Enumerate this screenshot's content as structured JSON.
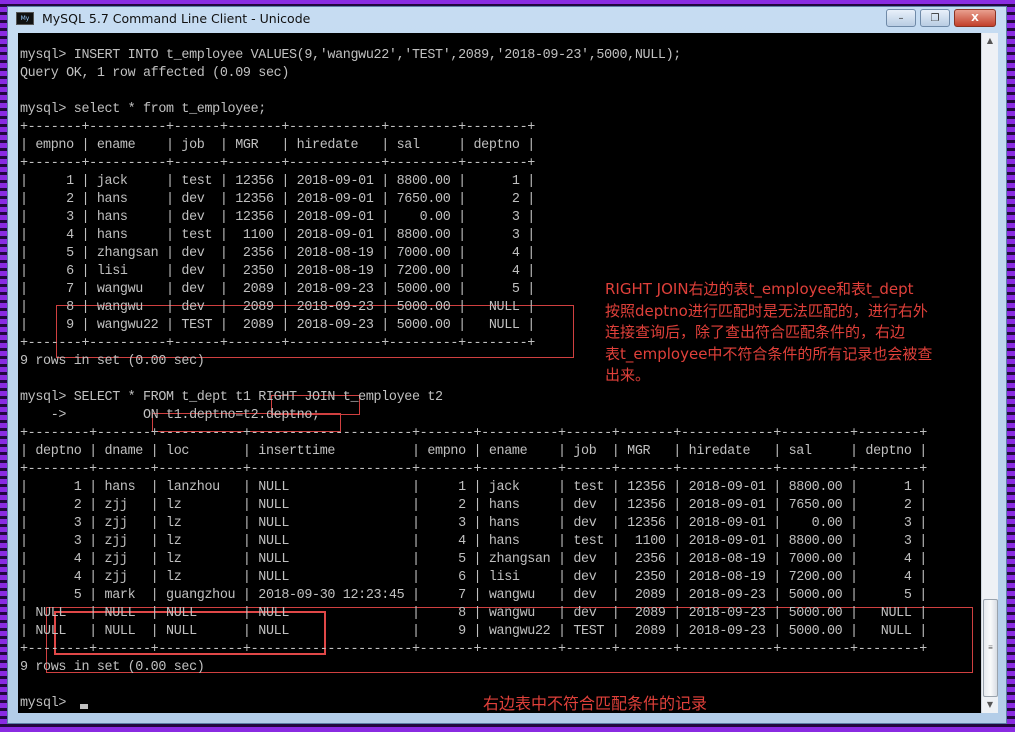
{
  "window": {
    "title": "MySQL 5.7 Command Line Client - Unicode",
    "icon": "mysql-console-icon",
    "buttons": {
      "minimize": "–",
      "restore": "❐",
      "close": "X"
    }
  },
  "console": {
    "lines": [
      "mysql> INSERT INTO t_employee VALUES(9,'wangwu22','TEST',2089,'2018-09-23',5000,NULL);",
      "Query OK, 1 row affected (0.09 sec)",
      "",
      "mysql> select * from t_employee;",
      "+-------+----------+------+-------+------------+---------+--------+",
      "| empno | ename    | job  | MGR   | hiredate   | sal     | deptno |",
      "+-------+----------+------+-------+------------+---------+--------+",
      "|     1 | jack     | test | 12356 | 2018-09-01 | 8800.00 |      1 |",
      "|     2 | hans     | dev  | 12356 | 2018-09-01 | 7650.00 |      2 |",
      "|     3 | hans     | dev  | 12356 | 2018-09-01 |    0.00 |      3 |",
      "|     4 | hans     | test |  1100 | 2018-09-01 | 8800.00 |      3 |",
      "|     5 | zhangsan | dev  |  2356 | 2018-08-19 | 7000.00 |      4 |",
      "|     6 | lisi     | dev  |  2350 | 2018-08-19 | 7200.00 |      4 |",
      "|     7 | wangwu   | dev  |  2089 | 2018-09-23 | 5000.00 |      5 |",
      "|     8 | wangwu   | dev  |  2089 | 2018-09-23 | 5000.00 |   NULL |",
      "|     9 | wangwu22 | TEST |  2089 | 2018-09-23 | 5000.00 |   NULL |",
      "+-------+----------+------+-------+------------+---------+--------+",
      "9 rows in set (0.00 sec)",
      "",
      "mysql> SELECT * FROM t_dept t1 RIGHT JOIN t_employee t2",
      "    ->          ON t1.deptno=t2.deptno;",
      "+--------+-------+-----------+---------------------+-------+----------+------+-------+------------+---------+--------+",
      "| deptno | dname | loc       | inserttime          | empno | ename    | job  | MGR   | hiredate   | sal     | deptno |",
      "+--------+-------+-----------+---------------------+-------+----------+------+-------+------------+---------+--------+",
      "|      1 | hans  | lanzhou   | NULL                |     1 | jack     | test | 12356 | 2018-09-01 | 8800.00 |      1 |",
      "|      2 | zjj   | lz        | NULL                |     2 | hans     | dev  | 12356 | 2018-09-01 | 7650.00 |      2 |",
      "|      3 | zjj   | lz        | NULL                |     3 | hans     | dev  | 12356 | 2018-09-01 |    0.00 |      3 |",
      "|      3 | zjj   | lz        | NULL                |     4 | hans     | test |  1100 | 2018-09-01 | 8800.00 |      3 |",
      "|      4 | zjj   | lz        | NULL                |     5 | zhangsan | dev  |  2356 | 2018-08-19 | 7000.00 |      4 |",
      "|      4 | zjj   | lz        | NULL                |     6 | lisi     | dev  |  2350 | 2018-08-19 | 7200.00 |      4 |",
      "|      5 | mark  | guangzhou | 2018-09-30 12:23:45 |     7 | wangwu   | dev  |  2089 | 2018-09-23 | 5000.00 |      5 |",
      "| NULL   | NULL  | NULL      | NULL                |     8 | wangwu   | dev  |  2089 | 2018-09-23 | 5000.00 |   NULL |",
      "| NULL   | NULL  | NULL      | NULL                |     9 | wangwu22 | TEST |  2089 | 2018-09-23 | 5000.00 |   NULL |",
      "+--------+-------+-----------+---------------------+-------+----------+------+-------+------------+---------+--------+",
      "9 rows in set (0.00 sec)",
      "",
      "mysql> "
    ]
  },
  "annotations": {
    "right_join_note": "RIGHT JOIN右边的表t_employee和表t_dept\n按照deptno进行匹配时是无法匹配的，进行右外\n连接查询后，除了查出符合匹配条件的，右边\n表t_employee中不符合条件的所有记录也会被查\n出来。",
    "bottom_note": "右边表中不符合匹配条件的记录",
    "color": "#e0403a"
  },
  "scrollbar": {
    "up": "▲",
    "down": "▼",
    "grip": "≡"
  }
}
